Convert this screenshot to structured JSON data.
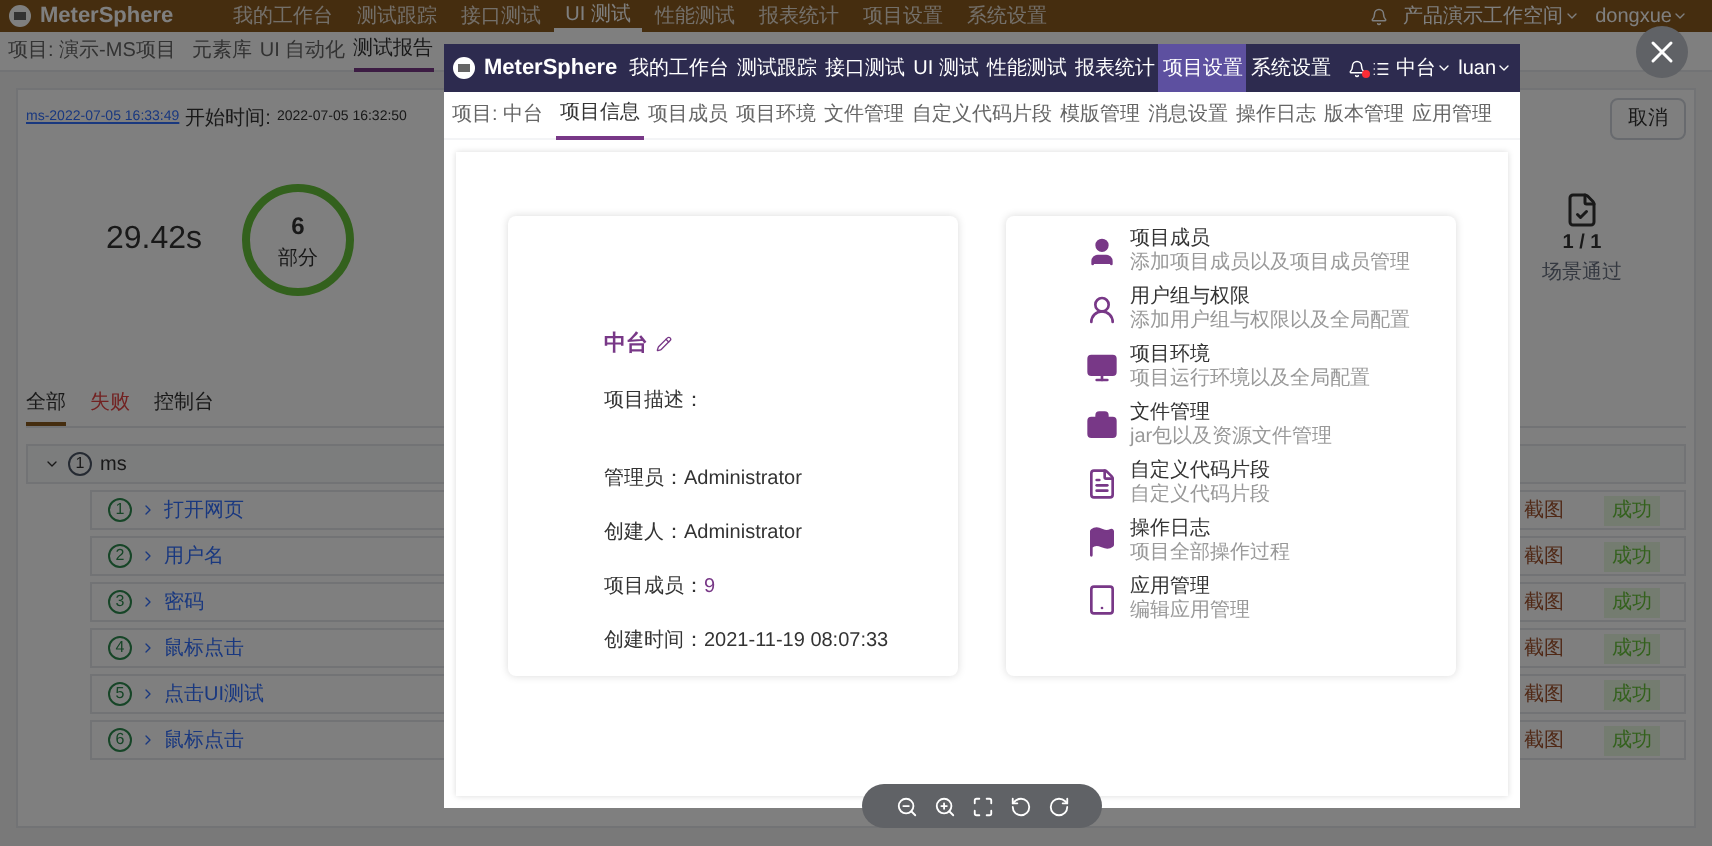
{
  "app": {
    "logo": "MeterSphere",
    "nav": [
      {
        "label": "我的工作台",
        "selected": false
      },
      {
        "label": "测试跟踪",
        "selected": false
      },
      {
        "label": "接口测试",
        "selected": false
      },
      {
        "label": "UI 测试",
        "selected": true
      },
      {
        "label": "性能测试",
        "selected": false
      },
      {
        "label": "报表统计",
        "selected": false
      },
      {
        "label": "项目设置",
        "selected": false
      },
      {
        "label": "系统设置",
        "selected": false
      }
    ],
    "workspace": "产品演示工作空间",
    "user": "dongxue"
  },
  "subbar": {
    "project": "项目: 演示-MS项目",
    "tabs": [
      {
        "label": "元素库",
        "selected": false
      },
      {
        "label": "UI 自动化",
        "selected": false
      },
      {
        "label": "测试报告",
        "selected": true
      }
    ]
  },
  "report": {
    "name": "ms-2022-07-05 16:33:49",
    "start_label": "开始时间:",
    "start_time": "2022-07-05 16:32:50",
    "duration": "29.42s",
    "count": "6",
    "count_label": "部分",
    "scenarios": "1 / 1",
    "scenarios_label": "场景通过",
    "cancel": "取消"
  },
  "result_tabs": [
    {
      "label": "全部",
      "selected": true,
      "kind": "all"
    },
    {
      "label": "失败",
      "selected": false,
      "kind": "failed"
    },
    {
      "label": "控制台",
      "selected": false,
      "kind": "console"
    }
  ],
  "tree": {
    "number": "1",
    "name": "ms",
    "expanded": true,
    "children": [
      {
        "number": "1",
        "name": "打开网页",
        "screenshot": "截图",
        "status": "成功"
      },
      {
        "number": "2",
        "name": "用户名",
        "screenshot": "截图",
        "status": "成功"
      },
      {
        "number": "3",
        "name": "密码",
        "screenshot": "截图",
        "status": "成功"
      },
      {
        "number": "4",
        "name": "鼠标点击",
        "screenshot": "截图",
        "status": "成功"
      },
      {
        "number": "5",
        "name": "点击UI测试",
        "screenshot": "截图",
        "status": "成功"
      },
      {
        "number": "6",
        "name": "鼠标点击",
        "screenshot": "截图",
        "status": "成功"
      }
    ]
  },
  "image": {
    "logo": "MeterSphere",
    "nav": [
      {
        "label": "我的工作台",
        "selected": false
      },
      {
        "label": "测试跟踪",
        "selected": false
      },
      {
        "label": "接口测试",
        "selected": false
      },
      {
        "label": "UI 测试",
        "selected": false
      },
      {
        "label": "性能测试",
        "selected": false
      },
      {
        "label": "报表统计",
        "selected": false
      },
      {
        "label": "项目设置",
        "selected": true
      },
      {
        "label": "系统设置",
        "selected": false
      }
    ],
    "workspace": "中台",
    "user": "luan",
    "project": "项目: 中台",
    "tabs": [
      {
        "label": "项目信息",
        "selected": true
      },
      {
        "label": "项目成员",
        "selected": false
      },
      {
        "label": "项目环境",
        "selected": false
      },
      {
        "label": "文件管理",
        "selected": false
      },
      {
        "label": "自定义代码片段",
        "selected": false
      },
      {
        "label": "模版管理",
        "selected": false
      },
      {
        "label": "消息设置",
        "selected": false
      },
      {
        "label": "操作日志",
        "selected": false
      },
      {
        "label": "版本管理",
        "selected": false
      },
      {
        "label": "应用管理",
        "selected": false
      }
    ],
    "info": {
      "name": "中台",
      "fields": [
        {
          "label": "项目描述："
        },
        {
          "label": "管理员：",
          "value": "Administrator"
        },
        {
          "label": "创建人：",
          "value": "Administrator"
        },
        {
          "label": "项目成员：",
          "value": "9",
          "kind": "link"
        },
        {
          "label": "创建时间：",
          "value": "2021-11-19 08:07:33"
        }
      ]
    },
    "modules": [
      {
        "kind": "user",
        "title": "项目成员",
        "desc": "添加项目成员以及项目成员管理"
      },
      {
        "kind": "user-outline",
        "title": "用户组与权限",
        "desc": "添加用户组与权限以及全局配置"
      },
      {
        "kind": "monitor",
        "title": "项目环境",
        "desc": "项目运行环境以及全局配置"
      },
      {
        "kind": "briefcase",
        "title": "文件管理",
        "desc": "jar包以及资源文件管理"
      },
      {
        "kind": "file",
        "title": "自定义代码片段",
        "desc": "自定义代码片段"
      },
      {
        "kind": "flag",
        "title": "操作日志",
        "desc": "项目全部操作过程"
      },
      {
        "kind": "tablet",
        "title": "应用管理",
        "desc": "编辑应用管理"
      }
    ]
  }
}
